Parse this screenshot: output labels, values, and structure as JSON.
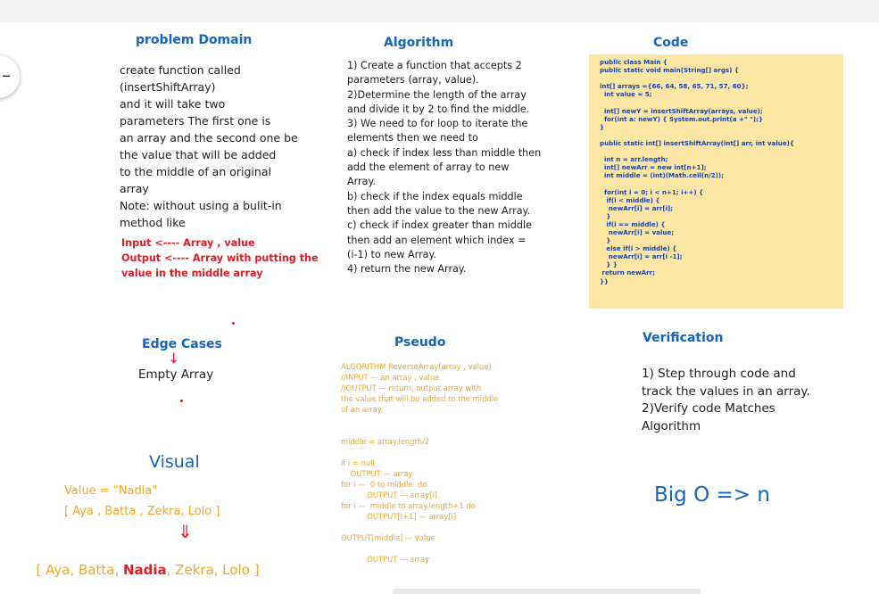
{
  "problem_domain": {
    "title": "problem Domain",
    "body": "create function called\n(insertShiftArray)\nand it will take two\nparameters The first one is\nan array and the second one be\nthe value that will be added\nto the middle of an original\narray\nNote: without using a bulit-in\nmethod like",
    "io": "Input <---- Array , value\nOutput <---- Array with putting the\nvalue in the middle array"
  },
  "algorithm": {
    "title": "Algorithm",
    "body": "1) Create a function that accepts 2\nparameters (array, value).\n2)Determine the length of the array\nand divide it by 2 to find the middle.\n3) We need to for loop to iterate the\nelements then we need to\na) check if index less than middle then\nadd the element of array to new\nArray.\nb) check if the index equals middle\nthen add the value to the new Array.\nc) check if index greater than middle\nthen add an element which index =\n(i-1) to new Array.\n4) return the new Array."
  },
  "code": {
    "title": "Code",
    "body": "public class Main {\npublic static void main(String[] args) {\n\nint[] arrays ={66, 64, 58, 65, 71, 57, 60};\n  int value = 5;\n\n  int[] newY = insertShiftArray(arrays, value);\n  for(int a: newY) { System.out.print(a +\" \");}\n}\n\npublic static int[] insertShiftArray(int[] arr, int value){\n\n  int n = arr.length;\n  int[] newArr = new int[n+1];\n  int middle = (int)(Math.ceil(n/2));\n\n  for(int i = 0; i < n+1; i++) {\n   if(i < middle) {\n    newArr[i] = arr[i];\n   }\n   if(i == middle) {\n    newArr[i] = value;\n   }\n   else if(i > middle) {\n    newArr[i] = arr[i -1];\n   } }\n return newArr;\n}}"
  },
  "edge_cases": {
    "title": "Edge Cases",
    "arrow": "↓",
    "body": "Empty Array"
  },
  "pseudo": {
    "title": "Pseudo",
    "body": "ALGORITHM ReverseArray(array , value)\n//INPUT — an array , value\n//OUTPUT — return, output array with\nthe value that will be added to the middle\nof an array\n\n\nmiddle = array.length/2\n\nif i = null\n    OUTPUT — array\nfor i —  0 to middle  do\n           OUTPUT — array[i]\nfor i —  middle to array.length+1 do\n           OUTPUT[i+1] — array[i]\n\nOUTPUT[middle] — value\n\n           OUTPUT — array"
  },
  "verification": {
    "title": "Verification",
    "body": "1) Step through code and\ntrack the values in an array.\n2)Verify code Matches\nAlgorithm"
  },
  "visual": {
    "title": "Visual",
    "value_line": "Value = \"Nadia\"",
    "input_array": "[ Aya , Batta , Zekra, Lolo ]",
    "arrow": "⇓",
    "result_prefix": "[ Aya, Batta, ",
    "result_highlight": "Nadia",
    "result_suffix": ", Zekra, Lolo ]"
  },
  "big_o": {
    "text": "Big O => n"
  },
  "colors": {
    "blue": "#1565c0",
    "red": "#e41b23",
    "orange": "#f5a623",
    "code_bg": "#fbe7a3",
    "code_text": "#1544c0"
  }
}
